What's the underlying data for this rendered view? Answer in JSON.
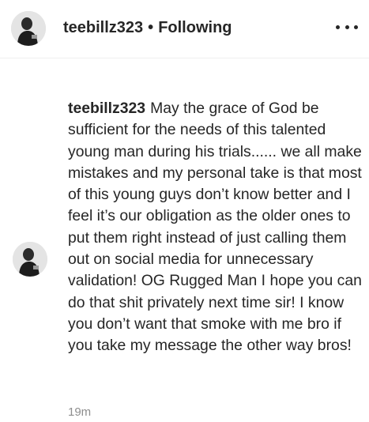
{
  "header": {
    "username": "teebillz323",
    "separator": "•",
    "follow_status": "Following",
    "more_icon": "more-horizontal-icon"
  },
  "comment": {
    "username": "teebillz323",
    "text": "May the grace of God be sufficient for the needs of this talented young man during his trials...... we all make mistakes and my personal take is that most of this young guys don’t know better and I feel it’s our obligation as the older ones to put them right instead of just calling them out on social media for unnecessary validation! OG Rugged Man I hope you can do that shit privately next time sir! I know you don’t want that smoke with me bro if you take my message the other way bros!",
    "time": "19m"
  }
}
